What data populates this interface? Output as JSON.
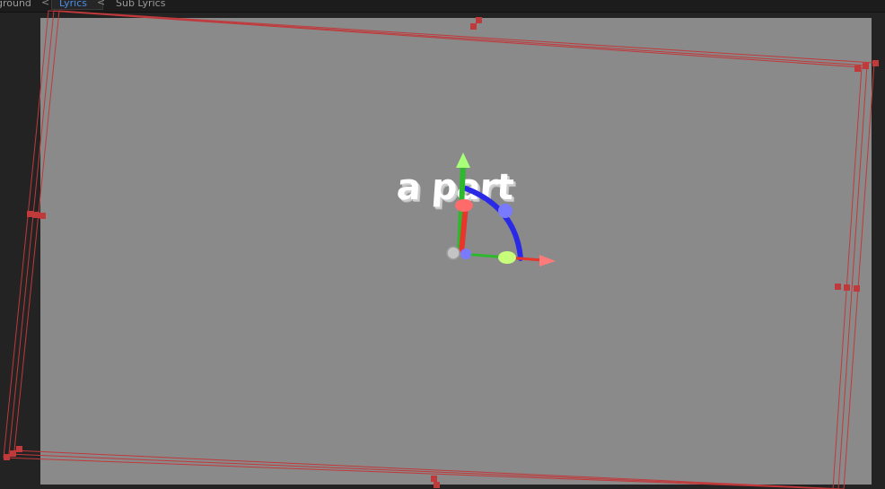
{
  "tabs": [
    {
      "label": "ground",
      "active": false
    },
    {
      "label": "Lyrics",
      "active": true
    },
    {
      "label": "Sub Lyrics",
      "active": false
    }
  ],
  "tab_separator": "<",
  "viewport": {
    "lyric_text": "a part",
    "background_color": "#8a8a8a",
    "bounds_color": "#c0393b"
  },
  "gizmo": {
    "x_axis_color": "#e8362d",
    "y_axis_color": "#2db82d",
    "z_rotation_color": "#2a2ae6"
  }
}
